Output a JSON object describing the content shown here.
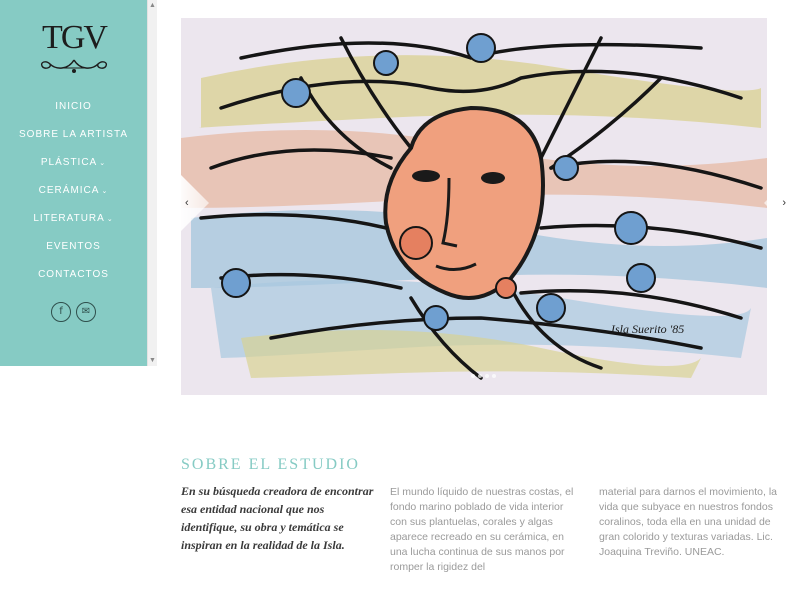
{
  "brand": {
    "logo_text": "TGV"
  },
  "nav": {
    "items": [
      {
        "label": "INICIO",
        "caret": ""
      },
      {
        "label": "SOBRE LA ARTISTA",
        "caret": ""
      },
      {
        "label": "PLÁSTICA",
        "caret": "⌄"
      },
      {
        "label": "CERÁMICA",
        "caret": "⌄"
      },
      {
        "label": "LITERATURA",
        "caret": "⌄"
      },
      {
        "label": "EVENTOS",
        "caret": ""
      },
      {
        "label": "CONTACTOS",
        "caret": ""
      }
    ],
    "active_index": 0
  },
  "social": {
    "facebook_glyph": "f",
    "mail_glyph": "✉"
  },
  "slider": {
    "prev_glyph": "‹",
    "next_glyph": "›",
    "signature": "Isla Suerito '85",
    "slide_count": 4,
    "active_slide": 0
  },
  "about": {
    "title": "SOBRE EL ESTUDIO",
    "lead": "En su búsqueda creadora de encontrar esa entidad nacional que nos identifique, su obra y temática se inspiran en la realidad de la Isla.",
    "col1": "El mundo líquido de nuestras costas, el fondo marino poblado de vida interior con sus plantuelas, corales y algas aparece recreado en su cerámica, en una lucha continua de sus manos por romper la rigidez del",
    "col2": "material para darnos el movimiento, la vida que subyace en nuestros fondos coralinos, toda ella en una unidad de gran colorido y texturas variadas. Lic. Joaquina Treviño. UNEAC."
  },
  "colors": {
    "accent": "#86cbc4",
    "text": "#3a3a3a",
    "muted": "#9a9a9a"
  }
}
